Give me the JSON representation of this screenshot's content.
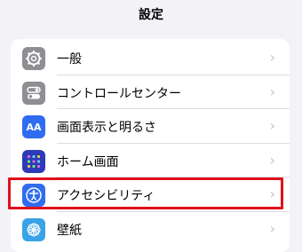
{
  "header": {
    "title": "設定"
  },
  "settings": {
    "items": [
      {
        "label": "一般",
        "icon": "gear-icon",
        "icon_bg": "#8e8e93"
      },
      {
        "label": "コントロールセンター",
        "icon": "control-center-toggles-icon",
        "icon_bg": "#8e8e93"
      },
      {
        "label": "画面表示と明るさ",
        "icon": "display-brightness-icon",
        "icon_bg": "#2f6cf0",
        "icon_text": "AA"
      },
      {
        "label": "ホーム画面",
        "icon": "home-screen-grid-icon",
        "icon_bg": "#2d3bb8"
      },
      {
        "label": "アクセシビリティ",
        "icon": "accessibility-person-icon",
        "icon_bg": "#2f6cf0",
        "highlighted": true
      },
      {
        "label": "壁紙",
        "icon": "wallpaper-flower-icon",
        "icon_bg": "#38a3e6"
      }
    ]
  },
  "colors": {
    "highlight_border": "#e0111b",
    "chevron": "#c4c4c7",
    "background": "#f2f2f7"
  }
}
